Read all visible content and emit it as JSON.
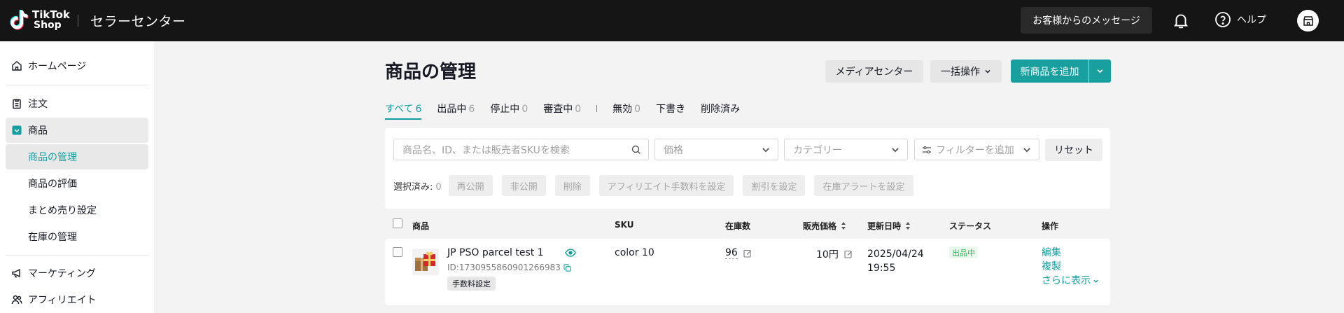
{
  "topbar": {
    "logo_line1": "TikTok",
    "logo_line2": "Shop",
    "title": "セラーセンター",
    "messages_label": "お客様からのメッセージ",
    "help_label": "ヘルプ"
  },
  "sidebar": {
    "items": [
      {
        "label": "ホームページ",
        "icon": "home-icon"
      },
      {
        "label": "注文",
        "icon": "clipboard-icon"
      },
      {
        "label": "商品",
        "icon": "product-icon"
      },
      {
        "label": "商品の管理"
      },
      {
        "label": "商品の評価"
      },
      {
        "label": "まとめ売り設定"
      },
      {
        "label": "在庫の管理"
      },
      {
        "label": "マーケティング",
        "icon": "megaphone-icon"
      },
      {
        "label": "アフィリエイト",
        "icon": "affiliate-icon"
      }
    ]
  },
  "page": {
    "title": "商品の管理",
    "media_center_label": "メディアセンター",
    "bulk_action_label": "一括操作",
    "add_product_label": "新商品を追加"
  },
  "tabs": [
    {
      "label": "すべて",
      "count": "6"
    },
    {
      "label": "出品中",
      "count": "6"
    },
    {
      "label": "停止中",
      "count": "0"
    },
    {
      "label": "審査中",
      "count": "0"
    },
    {
      "label": "無効",
      "count": "0"
    },
    {
      "label": "下書き",
      "count": ""
    },
    {
      "label": "削除済み",
      "count": ""
    }
  ],
  "filters": {
    "search_placeholder": "商品名、ID、または販売者SKUを検索",
    "price_placeholder": "価格",
    "category_placeholder": "カテゴリー",
    "add_filter_placeholder": "フィルターを追加",
    "reset_label": "リセット"
  },
  "bulk": {
    "selected_label": "選択済み:",
    "selected_count": "0",
    "buttons": [
      "再公開",
      "非公開",
      "削除",
      "アフィリエイト手数料を設定",
      "割引を設定",
      "在庫アラートを設定"
    ]
  },
  "table": {
    "columns": [
      "商品",
      "SKU",
      "在庫数",
      "販売価格",
      "更新日時",
      "ステータス",
      "操作"
    ],
    "rows": [
      {
        "name": "JP PSO parcel test 1",
        "id": "ID:1730955860901266983",
        "badge": "手数料設定",
        "sku": "color 10",
        "stock": "96",
        "price": "10円",
        "updated_date": "2025/04/24",
        "updated_time": "19:55",
        "status": "出品中",
        "actions": [
          "編集",
          "複製",
          "さらに表示"
        ]
      }
    ]
  },
  "colors": {
    "accent": "#139ea0",
    "topbar": "#151515",
    "status_green": "#1bbc4b"
  }
}
